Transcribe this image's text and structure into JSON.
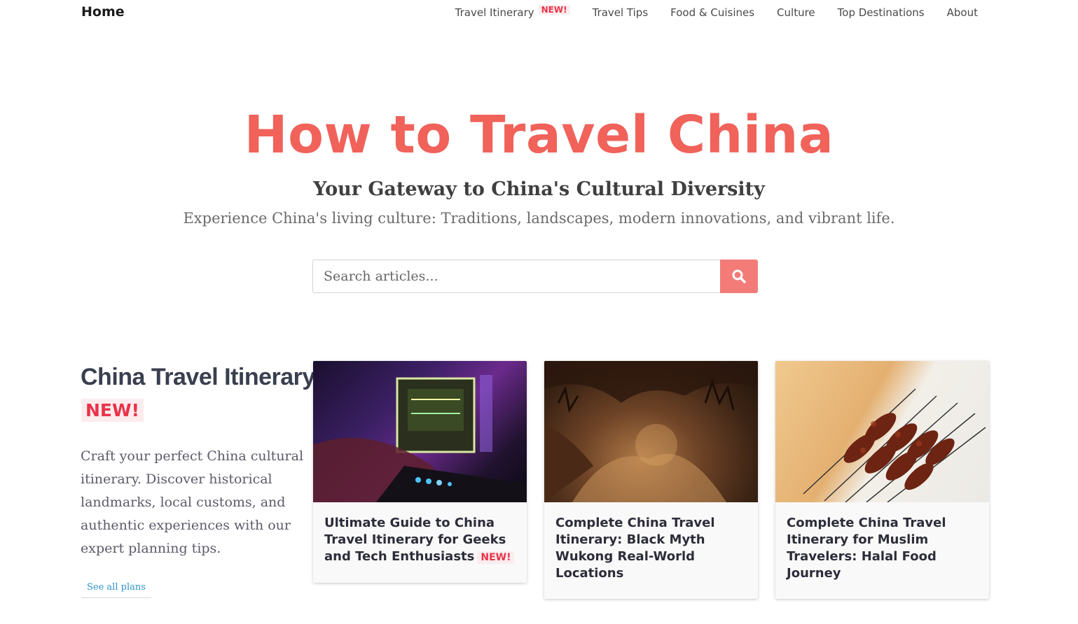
{
  "nav": {
    "home": "Home",
    "items": [
      {
        "label": "Travel Itinerary",
        "badge": "NEW!"
      },
      {
        "label": "Travel Tips"
      },
      {
        "label": "Food & Cuisines"
      },
      {
        "label": "Culture"
      },
      {
        "label": "Top Destinations"
      },
      {
        "label": "About"
      }
    ]
  },
  "hero": {
    "title": "How to Travel China",
    "subtitle": "Your Gateway to China's Cultural Diversity",
    "description": "Experience China's living culture: Traditions, landscapes, modern innovations, and vibrant life."
  },
  "search": {
    "placeholder": "Search articles...",
    "icon": "search-icon"
  },
  "section": {
    "title": "China Travel Itinerary",
    "badge": "NEW!",
    "description": "Craft your perfect China cultural itinerary. Discover historical landmarks, local customs, and authentic experiences with our expert planning tips.",
    "link": "See all plans"
  },
  "cards": [
    {
      "title": "Ultimate Guide to China Travel Itinerary for Geeks and Tech Enthusiasts",
      "badge": "NEW!"
    },
    {
      "title": "Complete China Travel Itinerary: Black Myth Wukong Real-World Locations"
    },
    {
      "title": "Complete China Travel Itinerary for Muslim Travelers: Halal Food Journey"
    }
  ],
  "colors": {
    "accent": "#f0625a",
    "badge": "#e8344a",
    "link": "#2b93c9"
  }
}
